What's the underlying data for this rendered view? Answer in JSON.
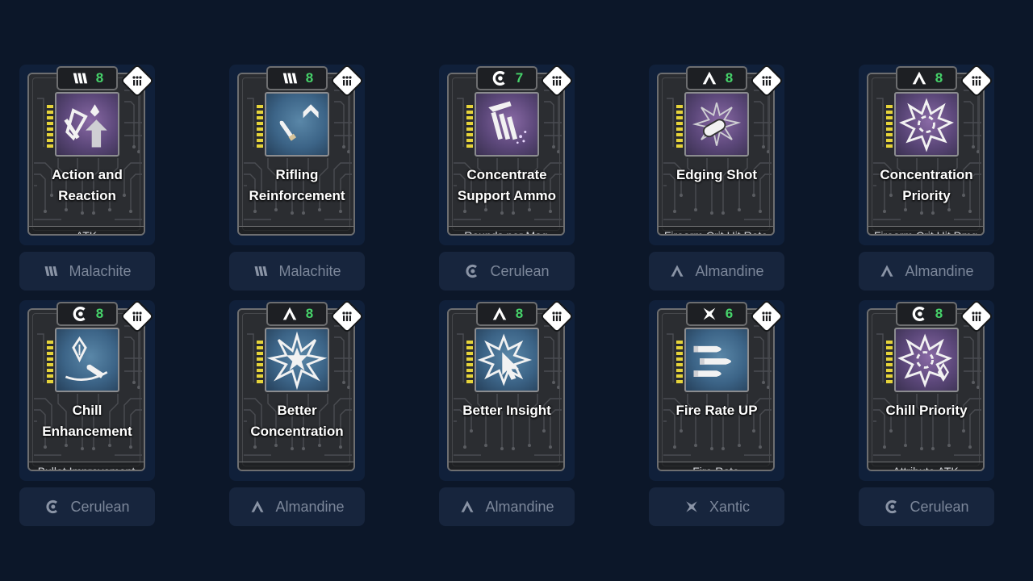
{
  "modules": [
    {
      "name_line1": "Action and",
      "name_line2": "Reaction",
      "stat": "ATK",
      "socket_icon": "malachite-icon",
      "cost": "8",
      "socket_label": "Malachite",
      "art_tone": "purple",
      "art_icon": "reaction-arrows-icon"
    },
    {
      "name_line1": "Rifling",
      "name_line2": "Reinforcement",
      "stat": "",
      "socket_icon": "malachite-icon",
      "cost": "8",
      "socket_label": "Malachite",
      "art_tone": "blue",
      "art_icon": "bullet-chevron-icon"
    },
    {
      "name_line1": "Concentrate",
      "name_line2": "Support Ammo",
      "stat": "Rounds per Mag",
      "socket_icon": "cerulean-icon",
      "cost": "7",
      "socket_label": "Cerulean",
      "art_tone": "purple",
      "art_icon": "ammo-belt-icon"
    },
    {
      "name_line1": "Edging Shot",
      "name_line2": "",
      "stat": "Firearm Crit Hit Rate",
      "socket_icon": "almandine-icon",
      "cost": "8",
      "socket_label": "Almandine",
      "art_tone": "purple",
      "art_icon": "bullet-burst-icon"
    },
    {
      "name_line1": "Concentration",
      "name_line2": "Priority",
      "stat": "Firearm Crit Hit Dmg",
      "socket_icon": "almandine-icon",
      "cost": "8",
      "socket_label": "Almandine",
      "art_tone": "purple",
      "art_icon": "starburst-ring-icon"
    },
    {
      "name_line1": "Chill",
      "name_line2": "Enhancement",
      "stat": "Bullet Improvement",
      "socket_icon": "cerulean-icon",
      "cost": "8",
      "socket_label": "Cerulean",
      "art_tone": "blue",
      "art_icon": "chill-bullet-icon"
    },
    {
      "name_line1": "Better",
      "name_line2": "Concentration",
      "stat": "",
      "socket_icon": "almandine-icon",
      "cost": "8",
      "socket_label": "Almandine",
      "art_tone": "blue",
      "art_icon": "starburst-icon"
    },
    {
      "name_line1": "Better Insight",
      "name_line2": "",
      "stat": "",
      "socket_icon": "almandine-icon",
      "cost": "8",
      "socket_label": "Almandine",
      "art_tone": "blue",
      "art_icon": "burst-cursor-icon"
    },
    {
      "name_line1": "Fire Rate UP",
      "name_line2": "",
      "stat": "Fire Rate",
      "socket_icon": "xantic-icon",
      "cost": "6",
      "socket_label": "Xantic",
      "art_tone": "blue",
      "art_icon": "triple-bullet-icon"
    },
    {
      "name_line1": "Chill Priority",
      "name_line2": "",
      "stat": "Attribute ATK",
      "socket_icon": "cerulean-icon",
      "cost": "8",
      "socket_label": "Cerulean",
      "art_tone": "purple",
      "art_icon": "chill-starburst-icon"
    }
  ],
  "colors": {
    "page_bg": "#0c1729",
    "cost_green": "#46d36a",
    "socket_text": "#7c879a",
    "yellow_accent": "#e6d43a"
  },
  "badge_icon": "tier-badge-icon"
}
